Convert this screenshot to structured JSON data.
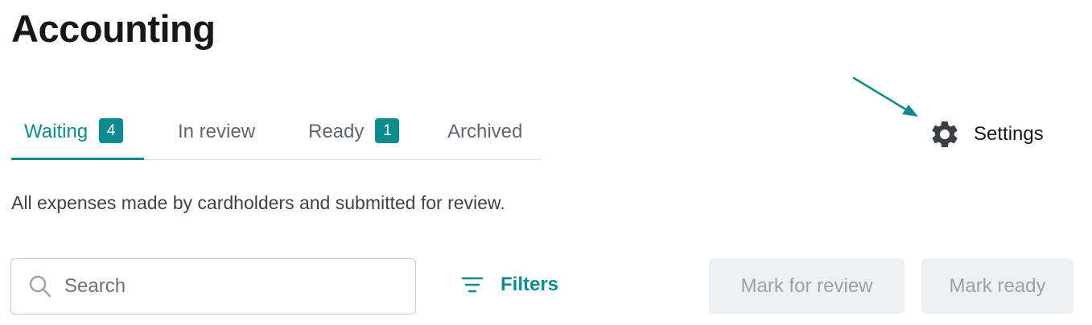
{
  "page": {
    "title": "Accounting",
    "description": "All expenses made by cardholders and submitted for review."
  },
  "tabs": [
    {
      "label": "Waiting",
      "badge": "4",
      "active": true
    },
    {
      "label": "In review",
      "badge": null,
      "active": false
    },
    {
      "label": "Ready",
      "badge": "1",
      "active": false
    },
    {
      "label": "Archived",
      "badge": null,
      "active": false
    }
  ],
  "settings": {
    "label": "Settings",
    "icon": "gear-icon"
  },
  "toolbar": {
    "search": {
      "placeholder": "Search",
      "value": "",
      "icon": "search-icon"
    },
    "filters_label": "Filters",
    "filters_icon": "filter-lines-icon",
    "mark_for_review_label": "Mark for review",
    "mark_ready_label": "Mark ready"
  },
  "colors": {
    "accent": "#0d8b8e",
    "disabled_button_bg": "#eef0f3",
    "disabled_button_text": "#9aa1aa"
  }
}
